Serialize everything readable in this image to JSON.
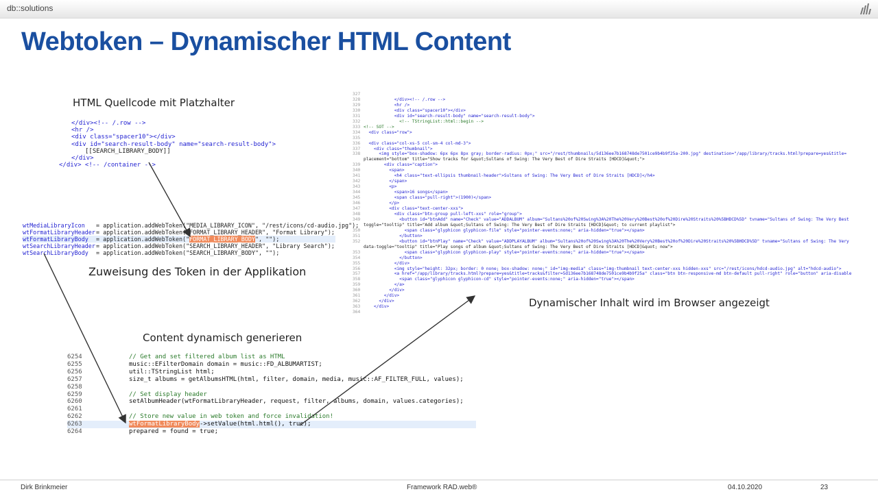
{
  "header": {
    "brand": "db::solutions"
  },
  "title": "Webtoken – Dynamischer HTML Content",
  "captions": {
    "html_source": "HTML Quellcode mit Platzhalter",
    "assignment": "Zuweisung des Token in der Applikation",
    "generate": "Content dynamisch generieren",
    "browser": "Dynamischer Inhalt wird im Browser angezeigt"
  },
  "html_snippet": [
    "</div><!-- /.row -->",
    "<hr />",
    "<div class=\"spacer10\"></div>",
    "<div id=\"search-result-body\" name=\"search-result-body\">",
    "[[SEARCH_LIBRARY_BODY]]",
    "</div>",
    "</div> <!-- /container -->"
  ],
  "token_code": [
    {
      "name": "wtMediaLibraryIcon",
      "code": "= application.addWebToken(\"MEDIA_LIBRARY_ICON\", \"/rest/icons/cd-audio.jpg\");"
    },
    {
      "name": "wtFormatLibraryHeader",
      "code": "= application.addWebToken(\"FORMAT_LIBRARY_HEADER\", \"Format Library\");"
    },
    {
      "name": "wtFormatLibraryBody",
      "pre": "= application.addWebToken(\"",
      "hl": "FORMAT_LIBRARY_BODY",
      "post": "\", \"\");"
    },
    {
      "name": "wtSearchLibraryHeader",
      "code": "= application.addWebToken(\"SEARCH_LIBRARY_HEADER\", \"Library Search\");"
    },
    {
      "name": "wtSearchLibraryBody",
      "code": "= application.addWebToken(\"SEARCH_LIBRARY_BODY\", \"\");"
    }
  ],
  "cpp_code": [
    {
      "n": "6254",
      "t": "// Get and set filtered album list as HTML"
    },
    {
      "n": "6255",
      "t": "music::EFilterDomain domain = music::FD_ALBUMARTIST;"
    },
    {
      "n": "6256",
      "t": "util::TStringList html;"
    },
    {
      "n": "6257",
      "t": "size_t albums = getAlbumsHTML(html, filter, domain, media, music::AF_FILTER_FULL, values);"
    },
    {
      "n": "6258",
      "t": ""
    },
    {
      "n": "6259",
      "t": "// Set display header"
    },
    {
      "n": "6260",
      "t": "setAlbumHeader(wtFormatLibraryHeader, request, filter, albums, domain, values.categories);"
    },
    {
      "n": "6261",
      "t": ""
    },
    {
      "n": "6262",
      "t": "// Store new value in web token and force invalidation!"
    },
    {
      "n": "6263",
      "hl": "wtFormatLibraryBody",
      "t": "->setValue(html.html(), true);"
    },
    {
      "n": "6264",
      "t": "prepared = found = true;"
    }
  ],
  "browser_code": [
    {
      "n": "327",
      "t": ""
    },
    {
      "n": "328",
      "t": "            </div><!-- /.row -->"
    },
    {
      "n": "329",
      "t": "            <hr />"
    },
    {
      "n": "330",
      "t": "            <div class=\"spacer10\"></div>"
    },
    {
      "n": "331",
      "t": "            <div id=\"search-result-body\" name=\"search-result-body\">"
    },
    {
      "n": "332",
      "t": "              <!-- TStringList::html::begin -->"
    },
    {
      "n": "333",
      "t": "<!-- SOT -->"
    },
    {
      "n": "334",
      "t": "  <div class=\"row\">"
    },
    {
      "n": "335",
      "t": ""
    },
    {
      "n": "336",
      "t": "  <div class=\"col-xs-5 col-sm-4 col-md-3\">"
    },
    {
      "n": "337",
      "t": "    <div class=\"thumbnail\">"
    },
    {
      "n": "338",
      "t": "      <img style=\"box-shadow: 6px 6px 8px gray; border-radius: 0px;\" src=\"/rest/thumbnails/5d136ee7b168748de7501ce9b4b9f25a-200.jpg\" destination=\"/app/library/tracks.html?prepare=yes&title="
    },
    {
      "n": "",
      "t": "placement=\"bottom\" title=\"Show tracks for &quot;Sultans of Swing: The Very Best of Dire Straits [HDCD]&quot;\">"
    },
    {
      "n": "339",
      "t": "        <div class=\"caption\">"
    },
    {
      "n": "340",
      "t": "          <span>"
    },
    {
      "n": "341",
      "t": "            <h4 class=\"text-ellipsis thumbnail-header\">Sultans of Swing: The Very Best of Dire Straits [HDCD]</h4>"
    },
    {
      "n": "342",
      "t": "          </span>"
    },
    {
      "n": "343",
      "t": "          <p>"
    },
    {
      "n": "344",
      "t": "            <span>16 songs</span>"
    },
    {
      "n": "345",
      "t": "            <span class=\"pull-right\">(1900)</span>"
    },
    {
      "n": "346",
      "t": "          </p>"
    },
    {
      "n": "347",
      "t": "          <div class=\"text-center-xxs\">"
    },
    {
      "n": "348",
      "t": "            <div class=\"btn-group pull-left-xxs\" role=\"group\">"
    },
    {
      "n": "349",
      "t": "              <button id=\"btnAdd\" name=\"Check\" value=\"ADDALBUM\" album=\"Sultans%20of%20Swing%3A%20The%20Very%20Best%20of%20Dire%20Straits%20%5BHDCD%5D\" tvname=\"Sultans of Swing: The Very Best"
    },
    {
      "n": "",
      "t": "toggle=\"tooltip\" title=\"Add album &quot;Sultans of Swing: The Very Best of Dire Straits [HDCD]&quot; to current playlist\">"
    },
    {
      "n": "350",
      "t": "                <span class=\"glyphicon glyphicon-file\" style=\"pointer-events:none;\" aria-hidden=\"true\"></span>"
    },
    {
      "n": "351",
      "t": "              </button>"
    },
    {
      "n": "352",
      "t": "              <button id=\"btnPlay\" name=\"Check\" value=\"ADDPLAYALBUM\" album=\"Sultans%20of%20Swing%3A%20The%20Very%20Best%20of%20Dire%20Straits%20%5BHDCD%5D\" tvname=\"Sultans of Swing: The Very"
    },
    {
      "n": "",
      "t": "data-toggle=\"tooltip\" title=\"Play songs of album &quot;Sultans of Swing: The Very Best of Dire Straits [HDCD]&quot; now\">"
    },
    {
      "n": "353",
      "t": "                <span class=\"glyphicon glyphicon-play\" style=\"pointer-events:none;\" aria-hidden=\"true\"></span>"
    },
    {
      "n": "354",
      "t": "              </button>"
    },
    {
      "n": "355",
      "t": "            </div>"
    },
    {
      "n": "356",
      "t": "            <img style=\"height: 32px; border: 0 none; box-shadow: none;\" id=\"img-media\" class=\"img-thumbnail text-center-xxs hidden-xxs\" src=\"/rest/icons/hdcd-audio.jpg\" alt=\"hdcd-audio\">"
    },
    {
      "n": "357",
      "t": "            <a href=\"/app/library/tracks.html?prepare=yes&title=tracks&filter=5d136ee7b168748de7501ce9b4b9f25a\" class=\"btn btn-responsive-md btn-default pull-right\" role=\"button\" aria-disable"
    },
    {
      "n": "358",
      "t": "              <span class=\"glyphicon glyphicon-cd\" style=\"pointer-events:none;\" aria-hidden=\"true\"></span>"
    },
    {
      "n": "359",
      "t": "            </a>"
    },
    {
      "n": "360",
      "t": "          </div>"
    },
    {
      "n": "361",
      "t": "        </div>"
    },
    {
      "n": "362",
      "t": "      </div>"
    },
    {
      "n": "363",
      "t": "    </div>"
    },
    {
      "n": "364",
      "t": ""
    }
  ],
  "footer": {
    "author": "Dirk Brinkmeier",
    "product": "Framework RAD.web®",
    "date": "04.10.2020",
    "page": "23"
  }
}
